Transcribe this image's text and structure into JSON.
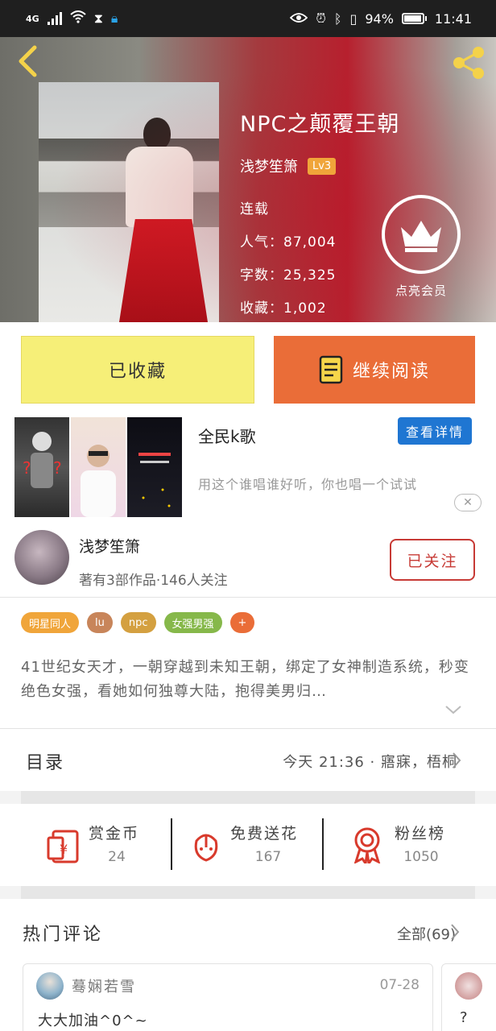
{
  "status_bar": {
    "network": "4G",
    "battery_text": "94%",
    "battery_level": 0.94,
    "time": "11:41"
  },
  "book": {
    "title": "NPC之颠覆王朝",
    "author": "浅梦笙箫",
    "level": "Lv3",
    "status": "连载",
    "popularity": "人气：87,004",
    "word_count": "字数：25,325",
    "favorites": "收藏：1,002"
  },
  "vip": {
    "label": "点亮会员"
  },
  "actions": {
    "favorited_label": "已收藏",
    "read_label": "继续阅读"
  },
  "ad": {
    "title": "全民k歌",
    "button_label": "查看详情",
    "description": "用这个谁唱谁好听，你也唱一个试试",
    "close_glyph": "✕"
  },
  "author_section": {
    "name": "浅梦笙箫",
    "meta": "著有3部作品·146人关注",
    "follow_label": "已关注"
  },
  "tags": [
    {
      "label": "明星同人",
      "color": "#f0a53a"
    },
    {
      "label": "lu",
      "color": "#c8855a"
    },
    {
      "label": "npc",
      "color": "#d4a040"
    },
    {
      "label": "女强男强",
      "color": "#86b84a"
    },
    {
      "label": "+",
      "color": "#ea6d38"
    }
  ],
  "description": "41世纪女天才，一朝穿越到未知王朝，绑定了女神制造系统，秒变绝色女强，看她如何独尊大陆，抱得美男归…",
  "catalog": {
    "label": "目录",
    "latest": "今天 21:36 · 寤寐，梧桐"
  },
  "rewards": [
    {
      "label": "赏金币",
      "value": "24",
      "icon": "gift-envelope-icon"
    },
    {
      "label": "免费送花",
      "value": "167",
      "icon": "flower-icon"
    },
    {
      "label": "粉丝榜",
      "value": "1050",
      "icon": "medal-icon"
    }
  ],
  "comments": {
    "title": "热门评论",
    "all_label": "全部(69)",
    "items": [
      {
        "user": "蓦娴若雪",
        "date": "07-28",
        "text": "大大加油^0^~"
      },
      {
        "text": "?"
      }
    ]
  },
  "colors": {
    "accent_orange": "#ea6d38",
    "favorite_yellow": "#f6ef78",
    "follow_red": "#c73a35",
    "ad_blue": "#1f76d2"
  }
}
